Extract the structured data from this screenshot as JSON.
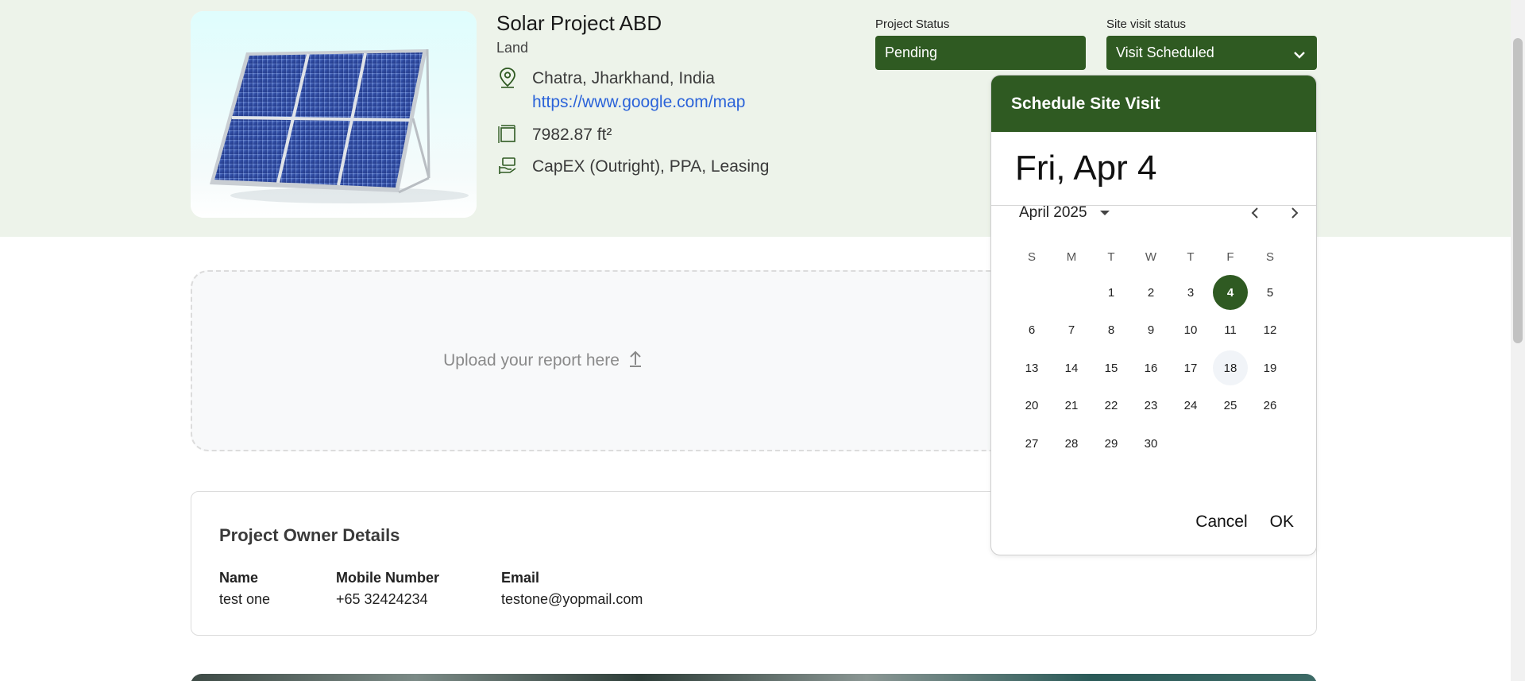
{
  "project": {
    "title": "Solar Project ABD",
    "type": "Land",
    "location": "Chatra, Jharkhand, India",
    "map_link": "https://www.google.com/map",
    "area": "7982.87 ft²",
    "financing": "CapEX (Outright), PPA, Leasing"
  },
  "status": {
    "project_label": "Project Status",
    "project_value": "Pending",
    "site_visit_label": "Site visit status",
    "site_visit_value": "Visit Scheduled"
  },
  "upload": {
    "text": "Upload your report here"
  },
  "owner": {
    "title": "Project Owner Details",
    "name_label": "Name",
    "name_value": "test one",
    "mobile_label": "Mobile Number",
    "mobile_value": "+65 32424234",
    "email_label": "Email",
    "email_value": "testone@yopmail.com"
  },
  "date_picker": {
    "title": "Schedule Site Visit",
    "selected_display": "Fri, Apr 4",
    "month_label": "April 2025",
    "weekdays": [
      "S",
      "M",
      "T",
      "W",
      "T",
      "F",
      "S"
    ],
    "first_weekday_index": 2,
    "days_in_month": 30,
    "selected_day": 4,
    "today_day": 18,
    "cancel_label": "Cancel",
    "ok_label": "OK"
  },
  "colors": {
    "brand_green": "#2f5a22",
    "hero_bg": "#edf3ea",
    "link_blue": "#2b63d9"
  },
  "icons": {
    "location": "location-pin-icon",
    "area": "area-icon",
    "financing": "money-hand-icon",
    "dropdown": "chevron-down-icon",
    "upload": "upload-arrow-icon",
    "prev": "chevron-left-icon",
    "next": "chevron-right-icon"
  }
}
